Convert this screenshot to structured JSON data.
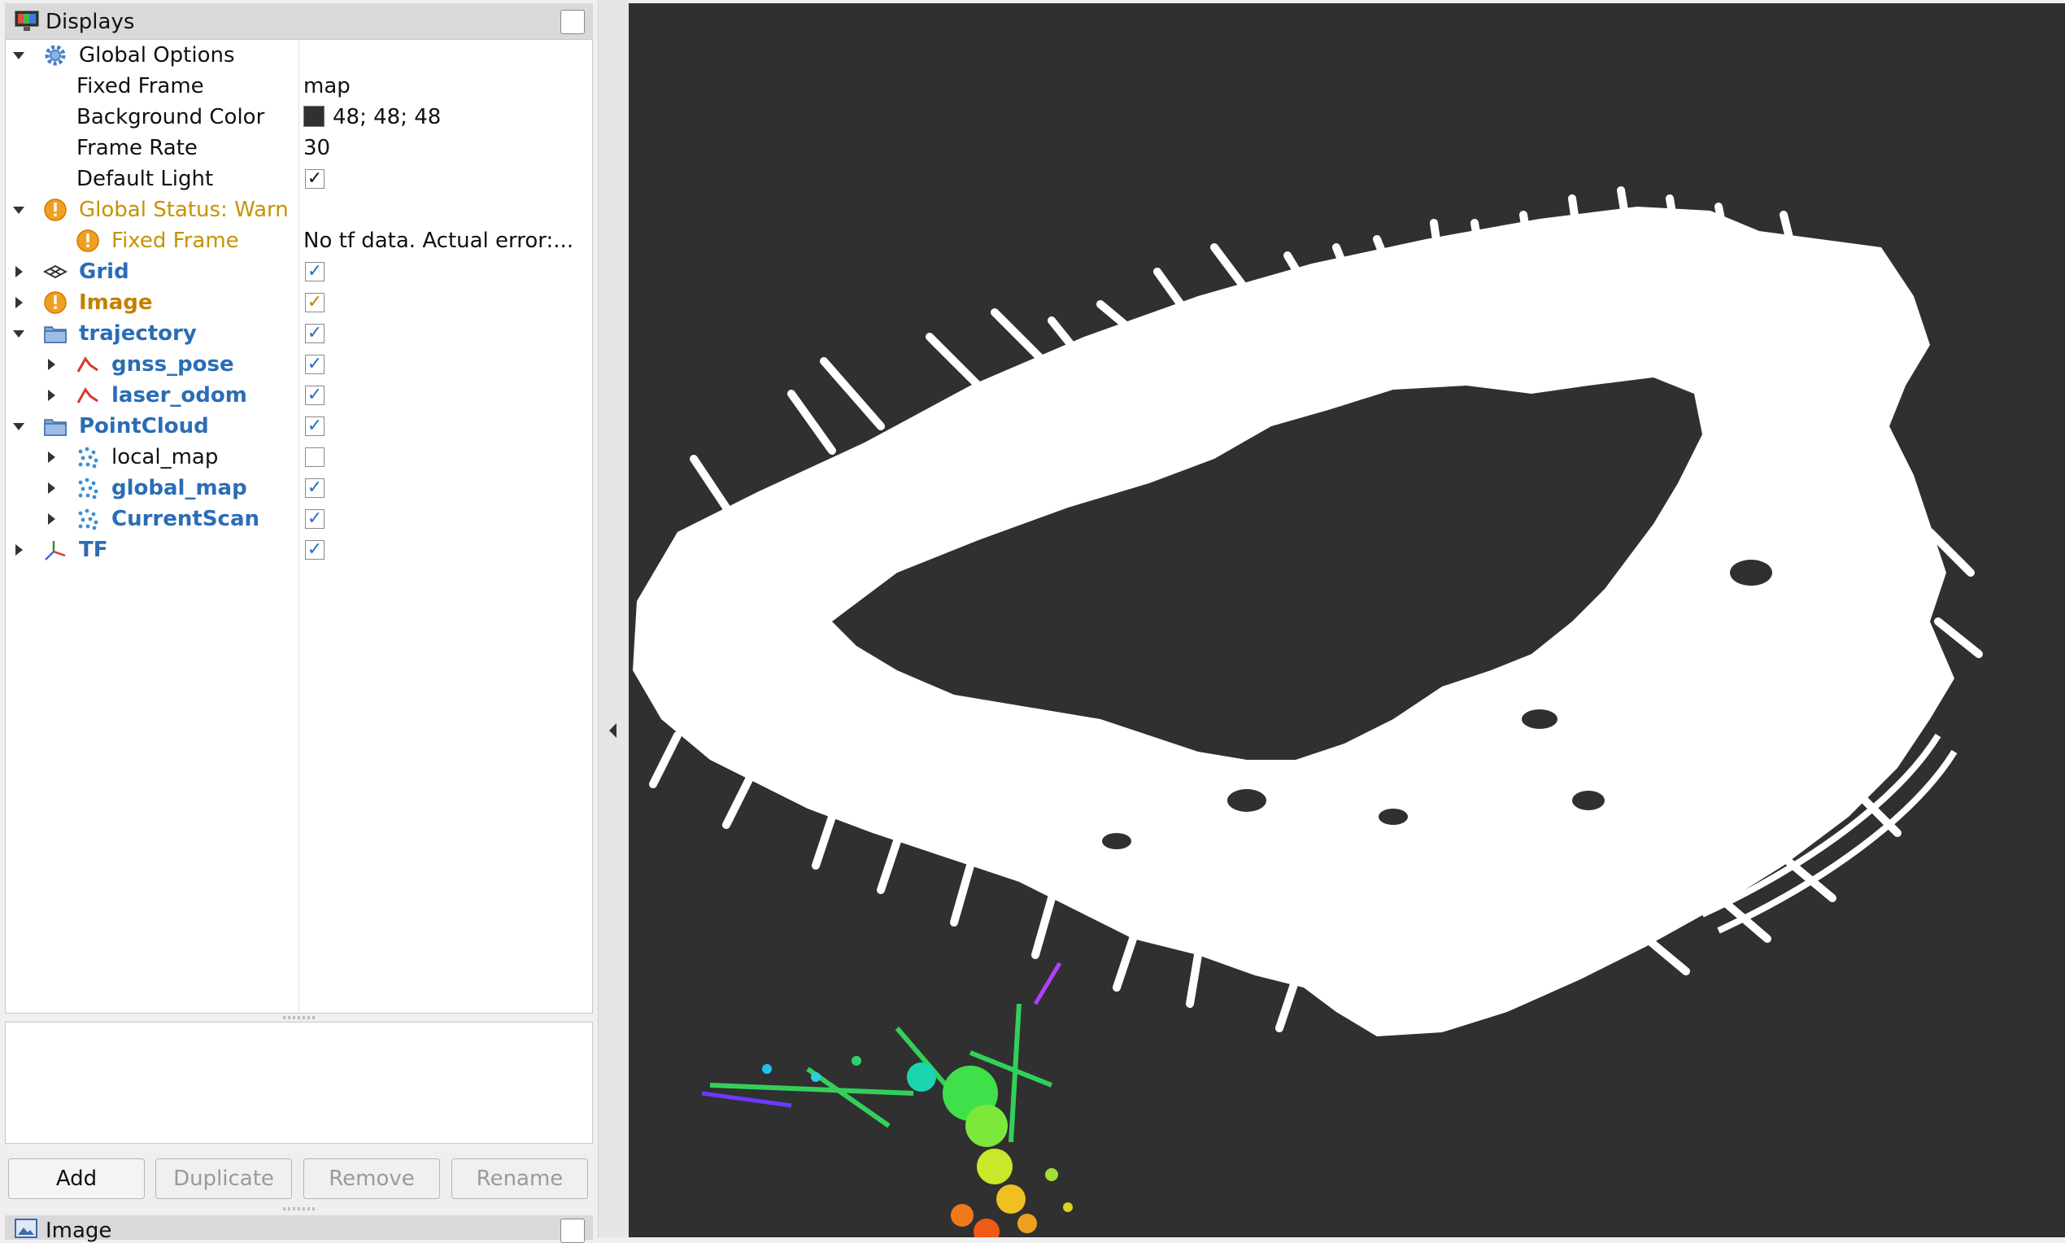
{
  "displays_panel": {
    "title": "Displays",
    "columns": [
      "",
      ""
    ],
    "global_options": {
      "label": "Global Options",
      "fixed_frame": {
        "label": "Fixed Frame",
        "value": "map"
      },
      "background_color": {
        "label": "Background Color",
        "value": "48; 48; 48",
        "color": "#303030"
      },
      "frame_rate": {
        "label": "Frame Rate",
        "value": "30"
      },
      "default_light": {
        "label": "Default Light",
        "checked": true
      }
    },
    "global_status": {
      "label": "Global Status: Warn",
      "fixed_frame": {
        "label": "Fixed Frame",
        "value": "No tf data.  Actual error:..."
      }
    },
    "items": {
      "grid": {
        "label": "Grid",
        "checked": true
      },
      "image": {
        "label": "Image",
        "checked": true
      },
      "trajectory": {
        "label": "trajectory",
        "checked": true
      },
      "gnss_pose": {
        "label": "gnss_pose",
        "checked": true
      },
      "laser_odom": {
        "label": "laser_odom",
        "checked": true
      },
      "pointcloud": {
        "label": "PointCloud",
        "checked": true
      },
      "local_map": {
        "label": "local_map",
        "checked": false
      },
      "global_map": {
        "label": "global_map",
        "checked": true
      },
      "current_scan": {
        "label": "CurrentScan",
        "checked": true
      },
      "tf": {
        "label": "TF",
        "checked": true
      }
    },
    "buttons": {
      "add": "Add",
      "duplicate": "Duplicate",
      "remove": "Remove",
      "rename": "Rename"
    }
  },
  "image_panel": {
    "title": "Image"
  },
  "colors": {
    "viewport_bg": "#303030",
    "bold_item": "#2a6db6",
    "warn": "#c79200",
    "warn_icon": "#f0a020"
  },
  "icons": [
    "monitor-icon",
    "gear-icon",
    "warning-icon",
    "grid-icon",
    "folder-icon",
    "path-icon",
    "pointcloud-icon",
    "axes-icon",
    "expand-arrow-icon",
    "collapse-arrow-icon"
  ]
}
